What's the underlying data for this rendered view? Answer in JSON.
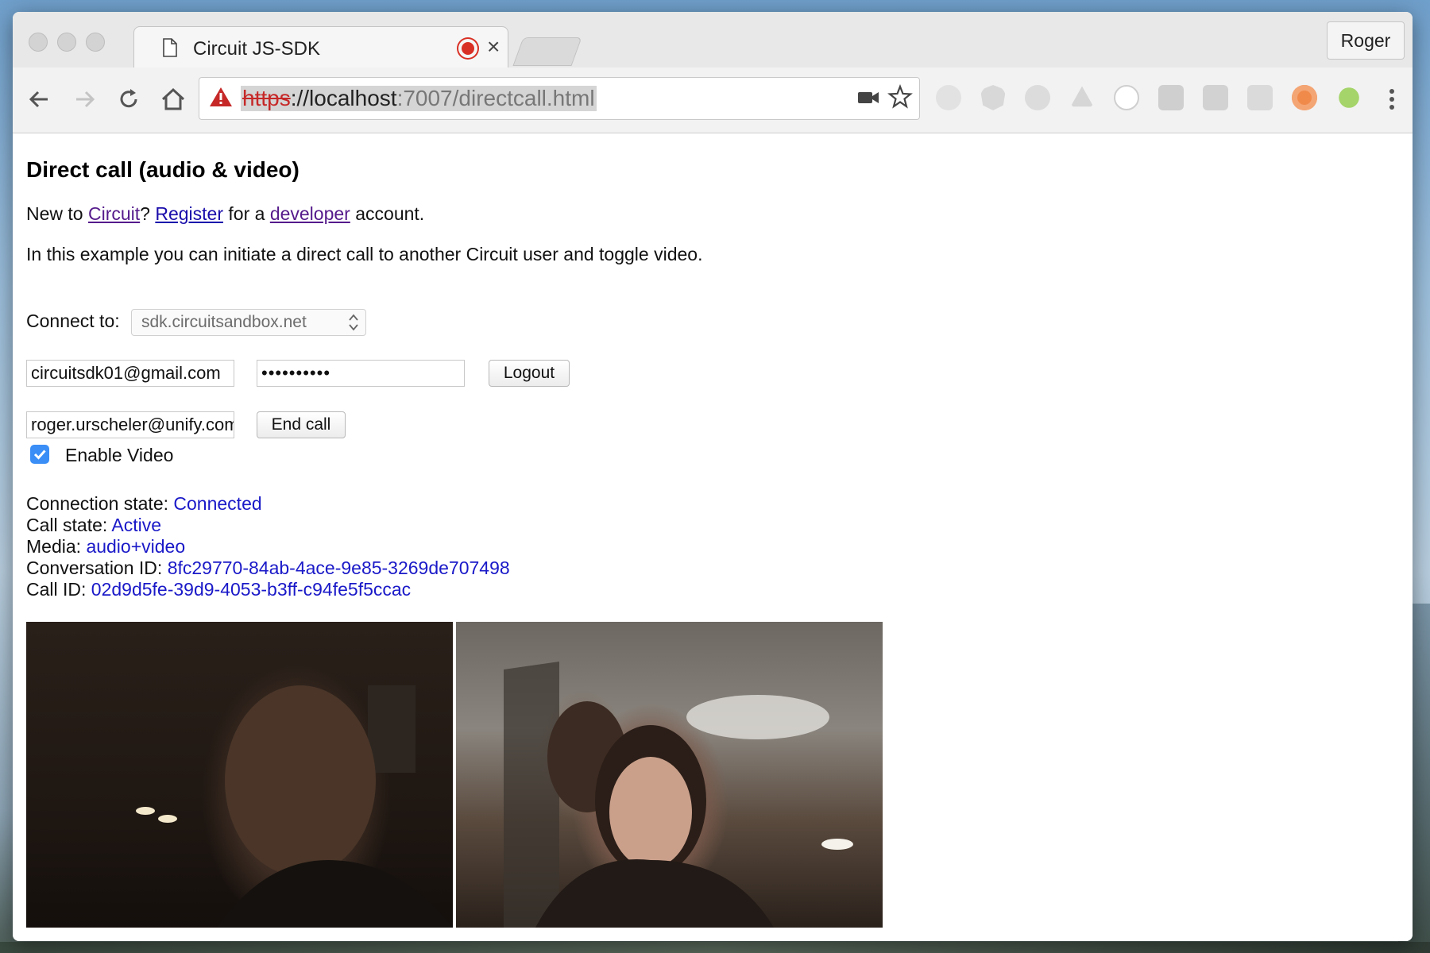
{
  "browser": {
    "tab_title": "Circuit JS-SDK",
    "tab_close": "×",
    "profile_name": "Roger",
    "url": {
      "scheme": "https",
      "rest_host": "://localhost",
      "port_path": ":7007/directcall.html"
    },
    "extensions": [
      "ext-icon-1",
      "angular-icon",
      "m-icon",
      "drive-icon",
      "json-icon",
      "ext-icon-6",
      "google-plus-icon",
      "ext-icon-8",
      "lifebuoy-icon",
      "c-icon"
    ]
  },
  "page": {
    "title": "Direct call (audio & video)",
    "intro": {
      "t1": "New to ",
      "link_circuit": "Circuit",
      "t2": "? ",
      "link_register": "Register",
      "t3": " for a ",
      "link_developer": "developer",
      "t4": " account."
    },
    "description": "In this example you can initiate a direct call to another Circuit user and toggle video.",
    "connect_label": "Connect to:",
    "connect_value": "sdk.circuitsandbox.net",
    "email_value": "circuitsdk01@gmail.com",
    "password_value": "••••••••••",
    "logout_label": "Logout",
    "callee_value": "roger.urscheler@unify.com",
    "end_call_label": "End call",
    "enable_video_label": "Enable Video",
    "enable_video_checked": true,
    "status": {
      "connection_label": "Connection state: ",
      "connection_value": "Connected",
      "call_label": "Call state: ",
      "call_value": "Active",
      "media_label": "Media: ",
      "media_value": "audio+video",
      "conversation_label": "Conversation ID: ",
      "conversation_value": "8fc29770-84ab-4ace-9e85-3269de707498",
      "callid_label": "Call ID: ",
      "callid_value": "02d9d5fe-39d9-4053-b3ff-c94fe5f5ccac"
    }
  },
  "colors": {
    "link": "#1a0dab",
    "visited_link": "#551a8b",
    "status_value": "#1a19c8",
    "checkbox": "#3a8ef6",
    "record": "#d93025"
  }
}
